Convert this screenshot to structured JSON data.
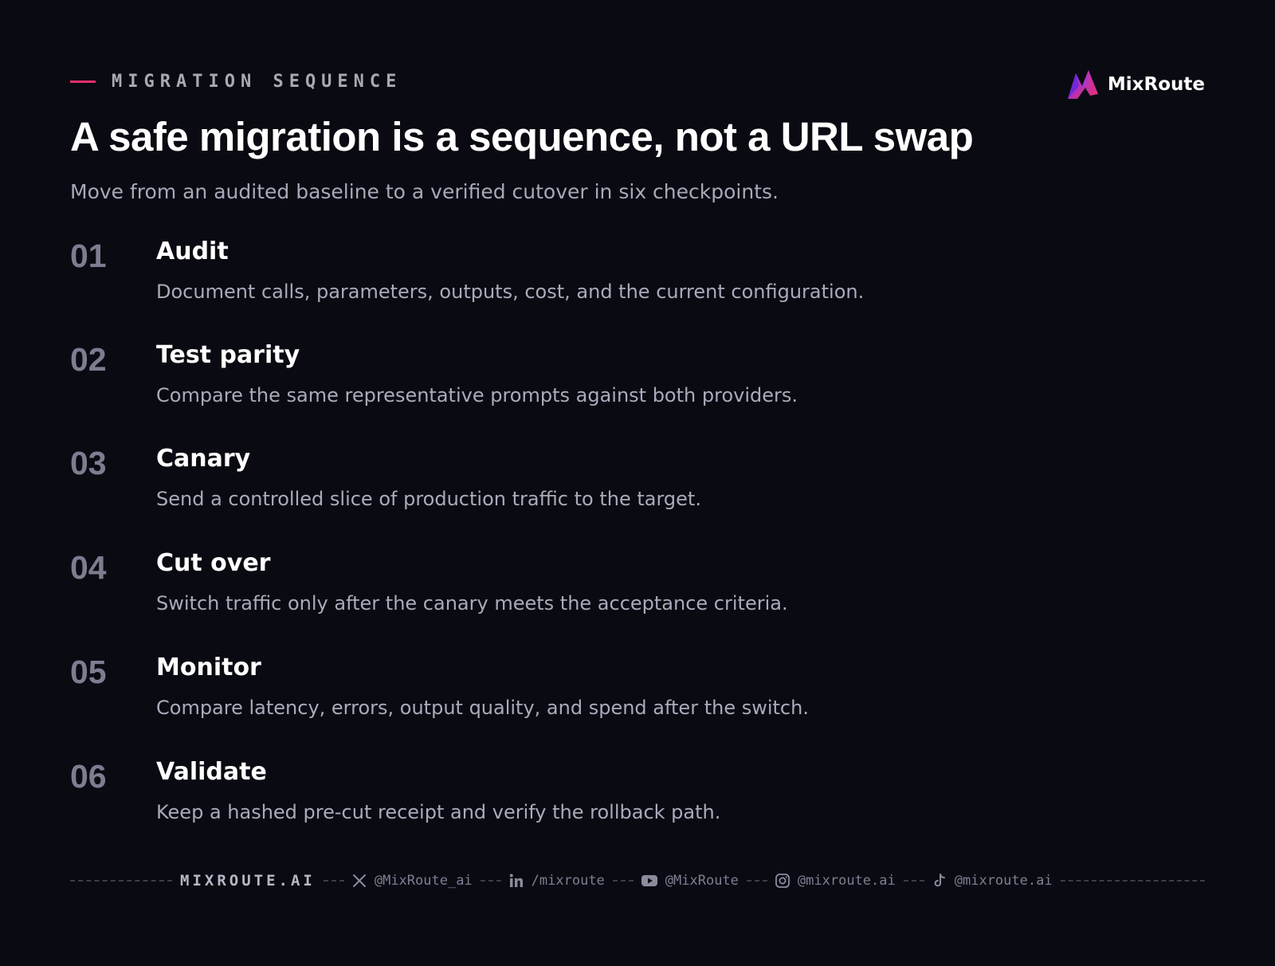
{
  "header": {
    "eyebrow": "MIGRATION SEQUENCE",
    "title": "A safe migration is a sequence, not a URL swap",
    "subtitle": "Move from an audited baseline to a verified cutover in six checkpoints."
  },
  "logo": {
    "name": "MixRoute",
    "icon": "mixroute-logo-icon"
  },
  "steps": [
    {
      "number": "01",
      "title": "Audit",
      "description": "Document calls, parameters, outputs, cost, and the current configuration."
    },
    {
      "number": "02",
      "title": "Test parity",
      "description": "Compare the same representative prompts against both providers."
    },
    {
      "number": "03",
      "title": "Canary",
      "description": "Send a controlled slice of production traffic to the target."
    },
    {
      "number": "04",
      "title": "Cut over",
      "description": "Switch traffic only after the canary meets the acceptance criteria."
    },
    {
      "number": "05",
      "title": "Monitor",
      "description": "Compare latency, errors, output quality, and spend after the switch."
    },
    {
      "number": "06",
      "title": "Validate",
      "description": "Keep a hashed pre-cut receipt and verify the rollback path."
    }
  ],
  "footer": {
    "brand": "MIXROUTE.AI",
    "socials": [
      {
        "icon": "x-icon",
        "handle": "@MixRoute_ai"
      },
      {
        "icon": "linkedin-icon",
        "handle": "/mixroute"
      },
      {
        "icon": "youtube-icon",
        "handle": "@MixRoute"
      },
      {
        "icon": "instagram-icon",
        "handle": "@mixroute.ai"
      },
      {
        "icon": "tiktok-icon",
        "handle": "@mixroute.ai"
      }
    ]
  },
  "colors": {
    "background": "#0a0a12",
    "accent": "#e3306c",
    "logo_gradient_start": "#7b2ff7",
    "logo_gradient_end": "#f0306c"
  }
}
